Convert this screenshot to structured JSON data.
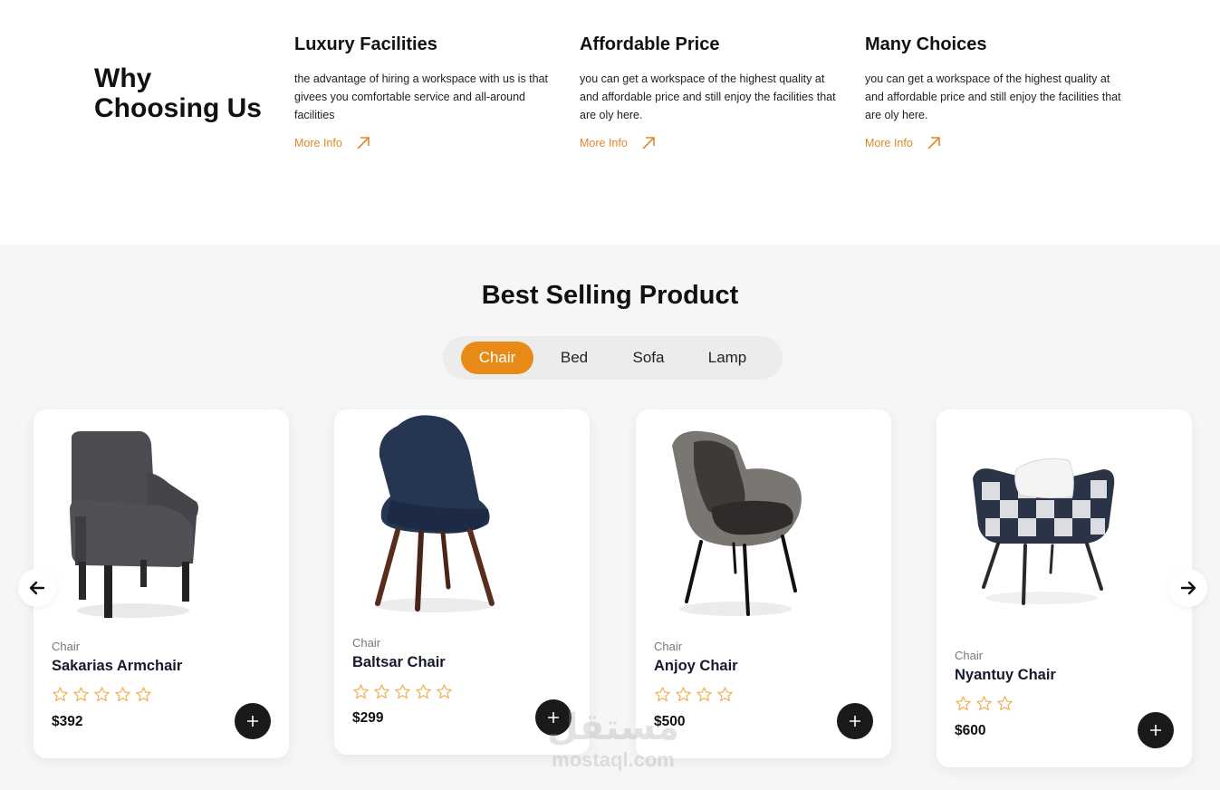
{
  "why": {
    "title": "Why Choosing Us",
    "features": [
      {
        "title": "Luxury Facilities",
        "text": "the advantage of hiring a workspace with us is that givees you comfortable service and all-around facilities",
        "link": "More Info"
      },
      {
        "title": "Affordable Price",
        "text": "you can get a workspace of the highest quality at and affordable price and still enjoy the facilities that are oly here.",
        "link": "More Info"
      },
      {
        "title": "Many Choices",
        "text": "you can get a workspace of the highest quality at and affordable price and still enjoy the facilities that are oly here.",
        "link": "More Info"
      }
    ]
  },
  "best": {
    "title": "Best Selling Product",
    "tabs": [
      "Chair",
      "Bed",
      "Sofa",
      "Lamp"
    ],
    "active_tab": "Chair",
    "products": [
      {
        "category": "Chair",
        "name": "Sakarias Armchair",
        "price": "$392",
        "stars": 5
      },
      {
        "category": "Chair",
        "name": "Baltsar Chair",
        "price": "$299",
        "stars": 5
      },
      {
        "category": "Chair",
        "name": "Anjoy Chair",
        "price": "$500",
        "stars": 4
      },
      {
        "category": "Chair",
        "name": "Nyantuy Chair",
        "price": "$600",
        "stars": 3
      }
    ]
  },
  "watermark": {
    "logo": "مستقل",
    "text": "mostaql.com"
  },
  "colors": {
    "accent": "#e88a16",
    "link": "#e0872c",
    "dark": "#1a1a1a",
    "section_bg": "#f6f6f6",
    "star": "#f0b35a"
  },
  "icons": {
    "more": "arrow-up-right-icon",
    "prev": "arrow-left-icon",
    "next": "arrow-right-icon",
    "add": "plus-icon",
    "rating": "star-outline-icon"
  }
}
